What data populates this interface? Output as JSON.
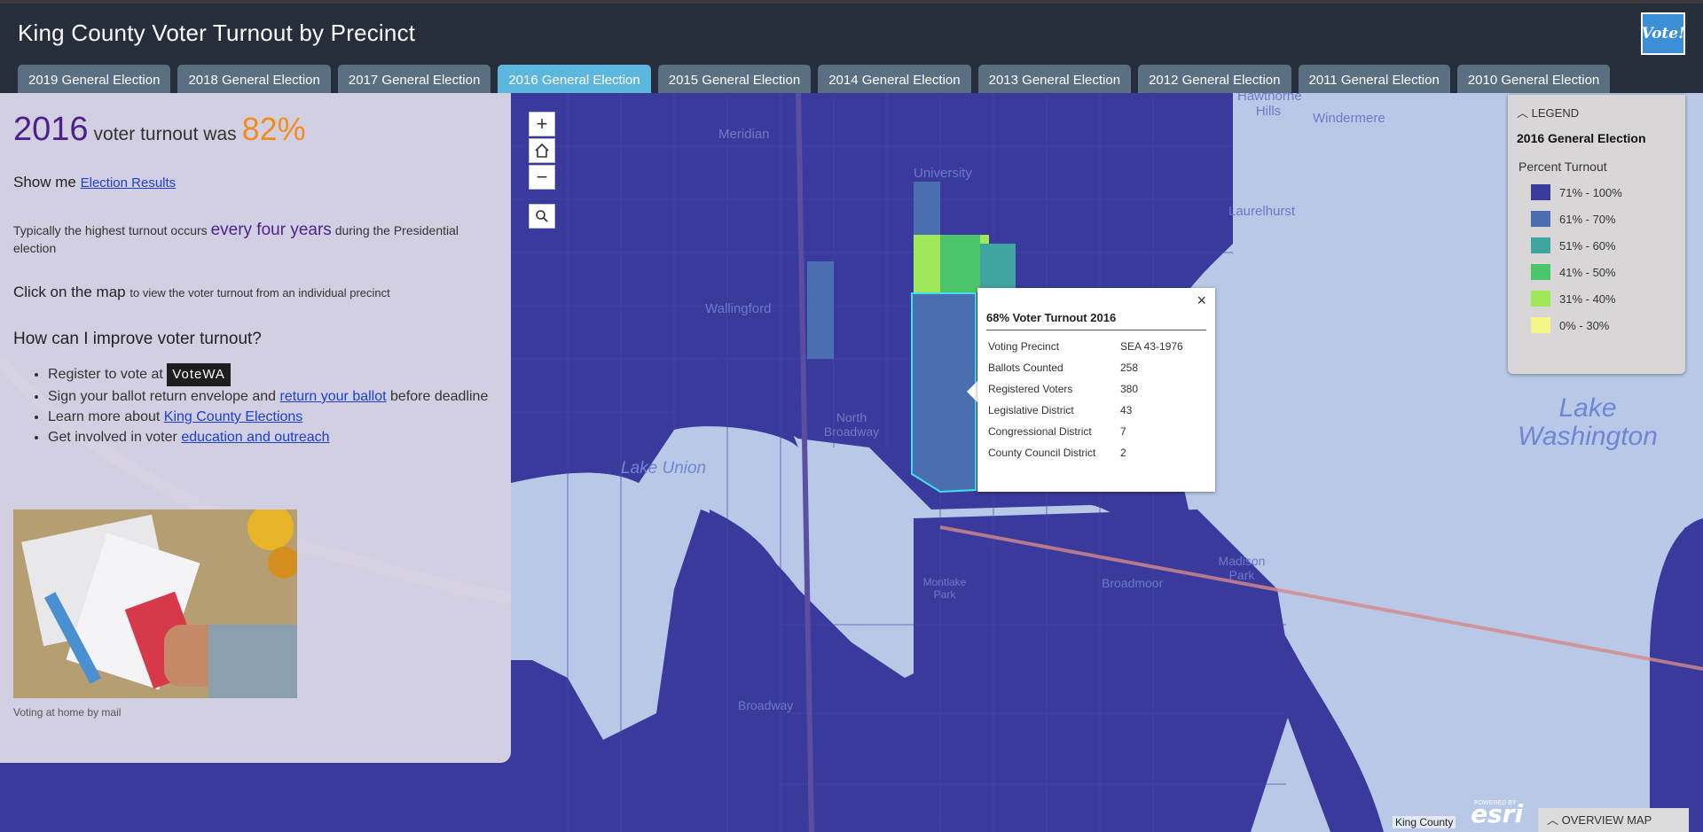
{
  "header": {
    "title": "King County Voter Turnout by Precinct",
    "logo_text": "Vote!"
  },
  "tabs": [
    {
      "label": "2019 General Election",
      "active": false
    },
    {
      "label": "2018 General Election",
      "active": false
    },
    {
      "label": "2017 General Election",
      "active": false
    },
    {
      "label": "2016 General Election",
      "active": true
    },
    {
      "label": "2015 General Election",
      "active": false
    },
    {
      "label": "2014 General Election",
      "active": false
    },
    {
      "label": "2013 General Election",
      "active": false
    },
    {
      "label": "2012 General Election",
      "active": false
    },
    {
      "label": "2011 General Election",
      "active": false
    },
    {
      "label": "2010 General Election",
      "active": false
    }
  ],
  "panel": {
    "year": "2016",
    "turnout_text": "voter turnout was",
    "turnout_pct": "82%",
    "show_me": "Show me",
    "election_results_link": "Election Results",
    "typical_pre": "Typically the highest turnout occurs",
    "typical_highlight": "every four years",
    "typical_post": "during the Presidential election",
    "click_map": "Click on the map",
    "click_map_sub": "to view the voter turnout from an individual precinct",
    "improve_heading": "How can I improve voter turnout?",
    "bullets": {
      "register_pre": "Register to vote at",
      "register_badge": "VoteWA",
      "sign_pre": "Sign your ballot return envelope and",
      "sign_link": "return your ballot",
      "sign_post": "before deadline",
      "learn_pre": "Learn more about",
      "learn_link": "King County Elections",
      "involved_pre": "Get involved in voter",
      "involved_link": "education and outreach"
    },
    "photo_caption": "Voting at home by mail"
  },
  "map_controls": {
    "zoom_in": "+",
    "zoom_out": "−",
    "home_icon": "home-icon",
    "search_icon": "search-icon"
  },
  "popup": {
    "close": "×",
    "title": "68% Voter Turnout 2016",
    "rows": [
      {
        "key": "Voting Precinct",
        "value": "SEA 43-1976"
      },
      {
        "key": "Ballots Counted",
        "value": "258"
      },
      {
        "key": "Registered Voters",
        "value": "380"
      },
      {
        "key": "Legislative District",
        "value": "43"
      },
      {
        "key": "Congressional District",
        "value": "7"
      },
      {
        "key": "County Council District",
        "value": "2"
      }
    ]
  },
  "legend": {
    "header": "LEGEND",
    "subtitle": "2016 General Election",
    "field": "Percent Turnout",
    "items": [
      {
        "label": "71% - 100%",
        "color": "#3b3b9c"
      },
      {
        "label": "61% - 70%",
        "color": "#4a6eb0"
      },
      {
        "label": "51% - 60%",
        "color": "#3fa5a0"
      },
      {
        "label": "41% - 50%",
        "color": "#4cc46a"
      },
      {
        "label": "31% - 40%",
        "color": "#9ee85a"
      },
      {
        "label": "0% - 30%",
        "color": "#f5f58a"
      }
    ]
  },
  "map_labels": {
    "lake_washington": "Lake Washington",
    "lake_union": "Lake Union",
    "wallingford": "Wallingford",
    "university": "University",
    "north_broadway": "North Broadway",
    "broadmoor": "Broadmoor",
    "laurelhurst": "Laurelhurst",
    "meridian": "Meridian",
    "windermere": "Windermere",
    "hawthorne_hills": "Hawthorne Hills",
    "madison_park": "Madison Park",
    "broadway": "Broadway",
    "montlake_park": "Montlake Park"
  },
  "footer": {
    "attribution": "King County",
    "esri_small": "POWERED BY",
    "esri": "esri",
    "overview": "OVERVIEW MAP"
  }
}
